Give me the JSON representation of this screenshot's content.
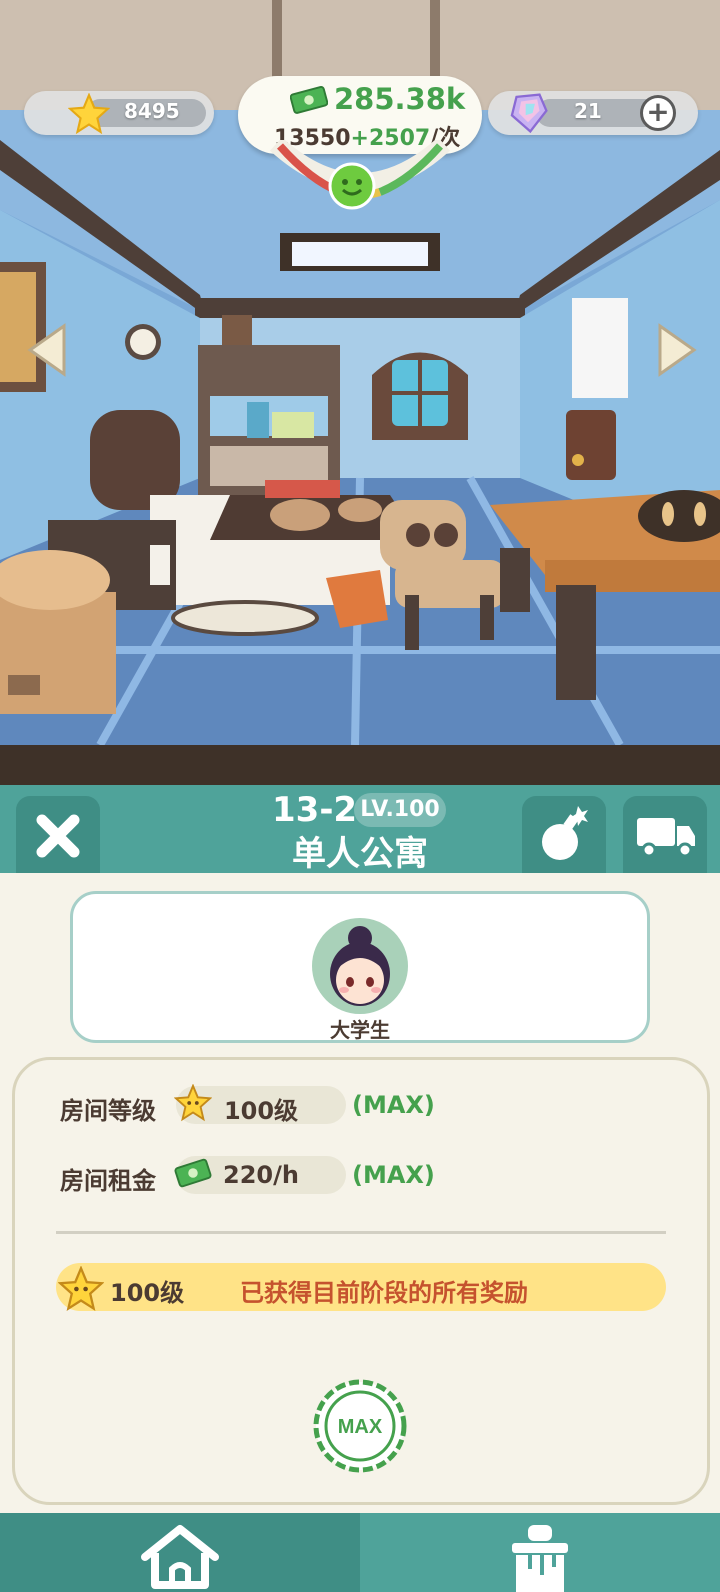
{
  "hud": {
    "stars": "8495",
    "gems": "21",
    "money_total": "285.38k",
    "money_base": "13550",
    "money_bonus": "+2507",
    "money_unit": "/次"
  },
  "room": {
    "code": "13-2",
    "level_badge": "LV.100",
    "name": "单人公寓"
  },
  "tenant": {
    "label": "大学生"
  },
  "stats": [
    {
      "label": "房间等级",
      "value": "100级",
      "max": "(MAX)",
      "icon": "star-icon"
    },
    {
      "label": "房间租金",
      "value": "220/h",
      "max": "(MAX)",
      "icon": "cash-icon"
    }
  ],
  "reward": {
    "level": "100级",
    "text": "已获得目前阶段的所有奖励"
  },
  "stamp": "MAX",
  "colors": {
    "teal": "#4fa39a",
    "teal_dark": "#3f8e85",
    "green": "#45a14d",
    "reward_yellow": "#ffe387",
    "reward_text": "#c5522e",
    "card_bg": "#f6f3e9"
  }
}
